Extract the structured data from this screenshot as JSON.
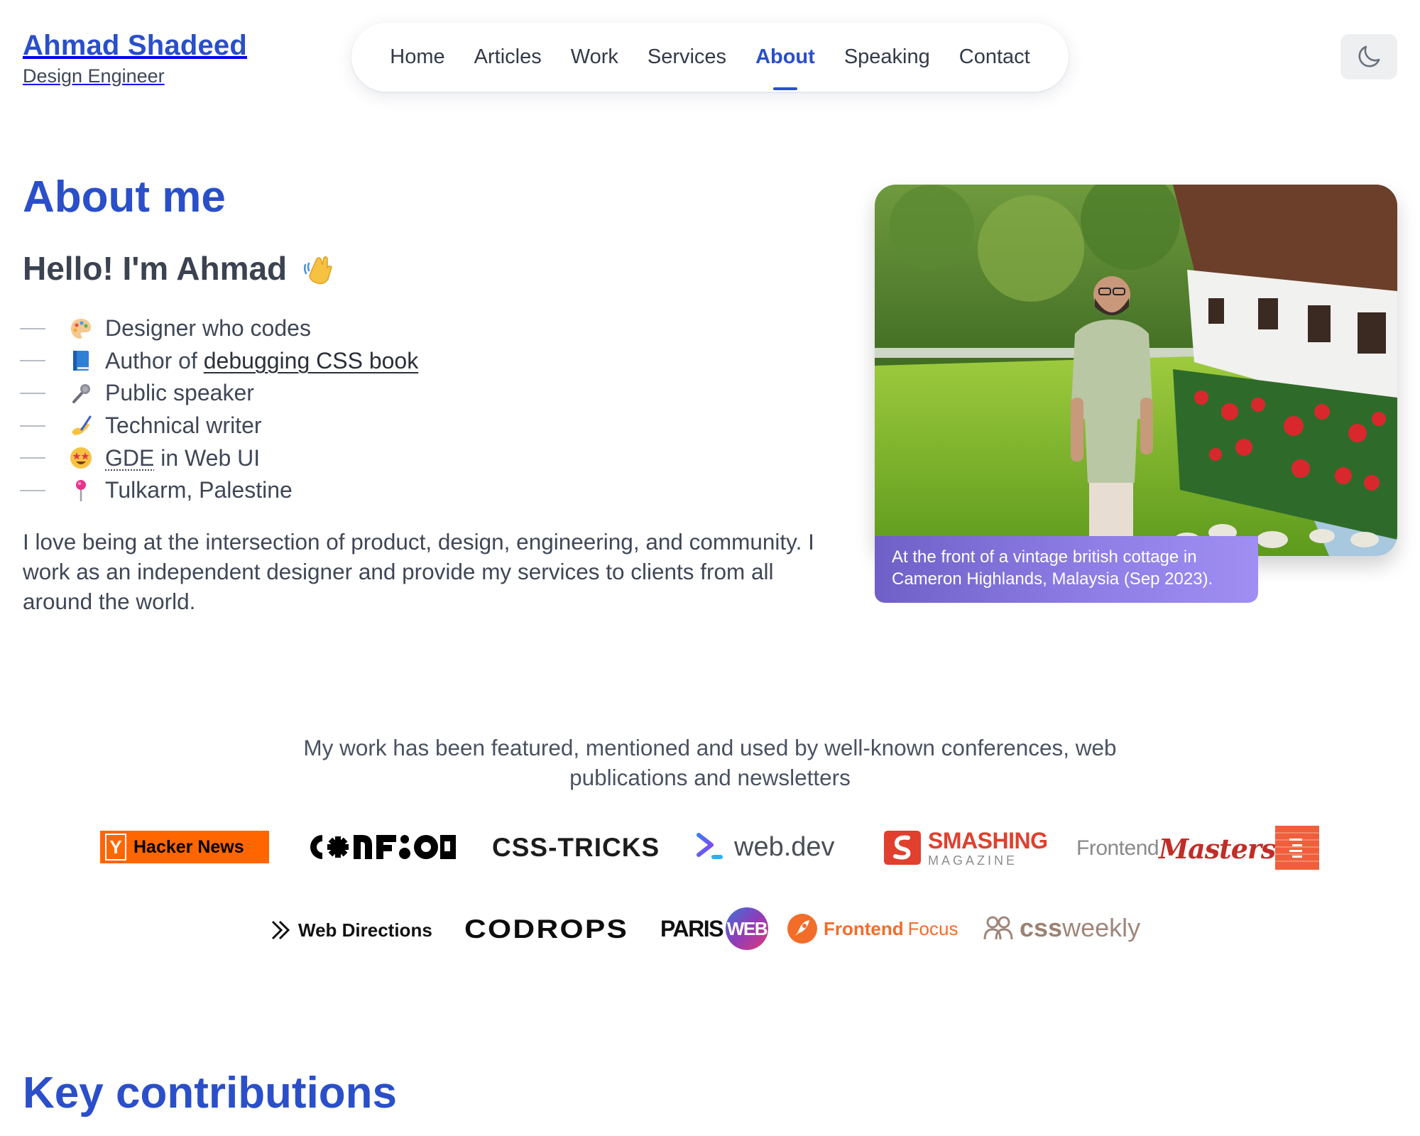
{
  "header": {
    "name": "Ahmad Shadeed",
    "role": "Design Engineer",
    "theme_toggle_icon": "moon-icon"
  },
  "nav": {
    "items": [
      {
        "label": "Home"
      },
      {
        "label": "Articles"
      },
      {
        "label": "Work"
      },
      {
        "label": "Services"
      },
      {
        "label": "About",
        "active": true
      },
      {
        "label": "Speaking"
      },
      {
        "label": "Contact"
      }
    ]
  },
  "about": {
    "title": "About me",
    "greeting": "Hello! I'm Ahmad",
    "greeting_icon": "waving-hand-icon",
    "facts": [
      {
        "icon": "palette-icon",
        "text": "Designer who codes"
      },
      {
        "icon": "book-icon",
        "prefix": "Author of ",
        "link": "debugging CSS book"
      },
      {
        "icon": "microphone-icon",
        "text": "Public speaker"
      },
      {
        "icon": "writing-hand-icon",
        "text": "Technical writer"
      },
      {
        "icon": "star-struck-icon",
        "abbr": "GDE",
        "suffix": " in Web UI"
      },
      {
        "icon": "pin-icon",
        "text": "Tulkarm, Palestine"
      }
    ],
    "intro": "I love being at the intersection of product, design, engineering, and community. I work as an independent designer and provide my services to clients from all around the world.",
    "photo_caption": "At the front of a vintage british cottage in Cameron Highlands, Malaysia (Sep 2023)."
  },
  "featured": {
    "text": "My work has been featured, mentioned and used by well-known conferences, web publications and newsletters",
    "logos": {
      "hacker_news": {
        "badge": "Y",
        "name": "Hacker News"
      },
      "css_tricks": "CSS-TRICKS",
      "web_dev": "web.dev",
      "smashing": {
        "top": "SMASHING",
        "bottom": "MAGAZINE"
      },
      "frontend_masters": {
        "light": "Frontend",
        "script": "Masters"
      },
      "web_directions": "Web Directions",
      "codrops": "CODROPS",
      "paris_web": {
        "left": "PARIS",
        "right": "WEB"
      },
      "frontend_focus": {
        "bold": "Frontend",
        "light": "Focus"
      },
      "css_weekly": {
        "bold": "css",
        "light": "weekly"
      }
    }
  },
  "colors": {
    "accent": "#2a4fc9",
    "text": "#3f4756",
    "hn_orange": "#ff6600",
    "smashing_red": "#e0402d",
    "fm_red": "#c02d28"
  },
  "key_contributions": {
    "title": "Key contributions"
  }
}
